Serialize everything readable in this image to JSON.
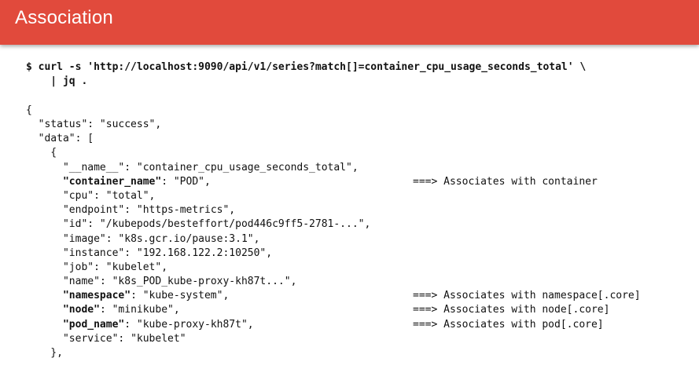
{
  "slide": {
    "title": "Association"
  },
  "command": {
    "line1": "$ curl -s 'http://localhost:9090/api/v1/series?match[]=container_cpu_usage_seconds_total' \\",
    "line2": "    | jq ."
  },
  "output": {
    "open_brace": "{",
    "status_line": "  \"status\": \"success\",",
    "data_line": "  \"data\": [",
    "item_open": "    {",
    "fields": [
      {
        "key": "\"__name__\"",
        "rest": ": \"container_cpu_usage_seconds_total\",",
        "strong": false,
        "annotation": ""
      },
      {
        "key": "\"container_name\"",
        "rest": ": \"POD\",",
        "strong": true,
        "annotation": "===> Associates with container"
      },
      {
        "key": "\"cpu\"",
        "rest": ": \"total\",",
        "strong": false,
        "annotation": ""
      },
      {
        "key": "\"endpoint\"",
        "rest": ": \"https-metrics\",",
        "strong": false,
        "annotation": ""
      },
      {
        "key": "\"id\"",
        "rest": ": \"/kubepods/besteffort/pod446c9ff5-2781-...\",",
        "strong": false,
        "annotation": ""
      },
      {
        "key": "\"image\"",
        "rest": ": \"k8s.gcr.io/pause:3.1\",",
        "strong": false,
        "annotation": ""
      },
      {
        "key": "\"instance\"",
        "rest": ": \"192.168.122.2:10250\",",
        "strong": false,
        "annotation": ""
      },
      {
        "key": "\"job\"",
        "rest": ": \"kubelet\",",
        "strong": false,
        "annotation": ""
      },
      {
        "key": "\"name\"",
        "rest": ": \"k8s_POD_kube-proxy-kh87t...\",",
        "strong": false,
        "annotation": ""
      },
      {
        "key": "\"namespace\"",
        "rest": ": \"kube-system\",",
        "strong": true,
        "annotation": "===> Associates with namespace[.core]"
      },
      {
        "key": "\"node\"",
        "rest": ": \"minikube\",",
        "strong": true,
        "annotation": "===> Associates with node[.core]"
      },
      {
        "key": "\"pod_name\"",
        "rest": ": \"kube-proxy-kh87t\",",
        "strong": true,
        "annotation": "===> Associates with pod[.core]"
      },
      {
        "key": "\"service\"",
        "rest": ": \"kubelet\"",
        "strong": false,
        "annotation": ""
      }
    ],
    "item_close": "    },"
  }
}
